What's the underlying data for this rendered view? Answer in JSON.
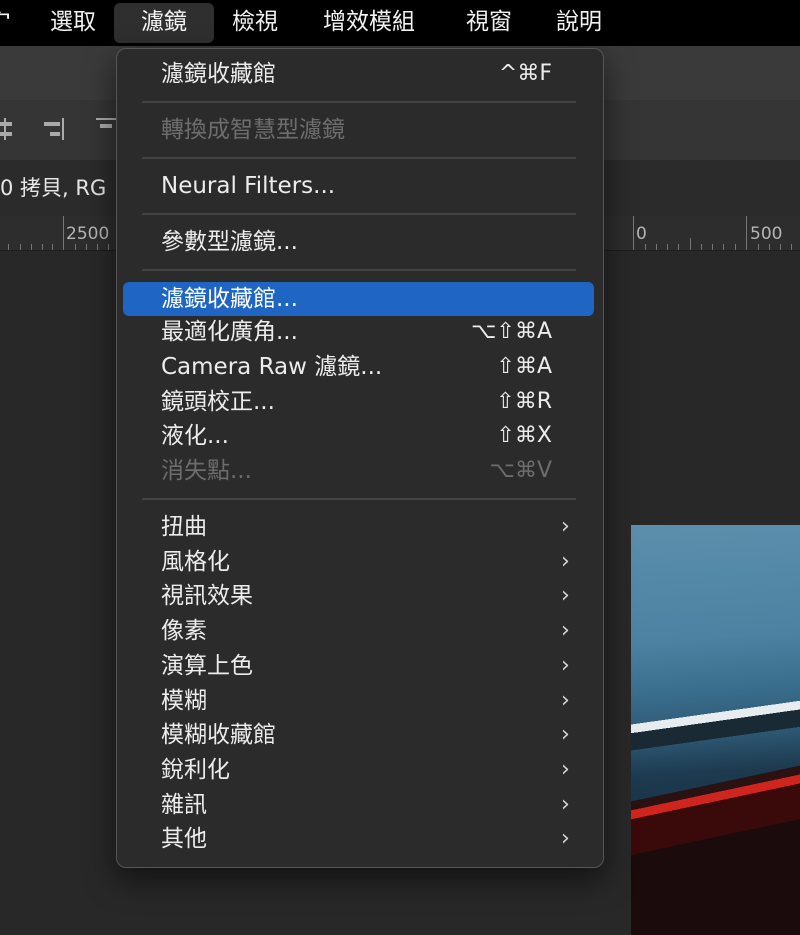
{
  "menubar": {
    "partial": "宀",
    "items": [
      "選取",
      "濾鏡",
      "檢視",
      "增效模組",
      "視窗",
      "說明"
    ]
  },
  "document": {
    "tab_title": "0 拷貝, RG",
    "ruler": [
      "2500",
      "0",
      "500"
    ]
  },
  "filter_menu": {
    "top": {
      "label": "濾鏡收藏館",
      "shortcut": "^⌘F"
    },
    "convert": "轉換成智慧型濾鏡",
    "neural": "Neural Filters...",
    "parametric": "參數型濾鏡...",
    "gallery": "濾鏡收藏館...",
    "adaptive": {
      "label": "最適化廣角...",
      "shortcut": "⌥⇧⌘A"
    },
    "camera_raw": {
      "label": "Camera Raw 濾鏡...",
      "shortcut": "⇧⌘A"
    },
    "lens": {
      "label": "鏡頭校正...",
      "shortcut": "⇧⌘R"
    },
    "liquify": {
      "label": "液化...",
      "shortcut": "⇧⌘X"
    },
    "vanishing": {
      "label": "消失點...",
      "shortcut": "⌥⌘V"
    },
    "submenus": [
      "扭曲",
      "風格化",
      "視訊效果",
      "像素",
      "演算上色",
      "模糊",
      "模糊收藏館",
      "銳利化",
      "雜訊",
      "其他"
    ]
  },
  "colors": {
    "highlight": "#1f65c4",
    "menu_bg": "#2b2b2b"
  }
}
